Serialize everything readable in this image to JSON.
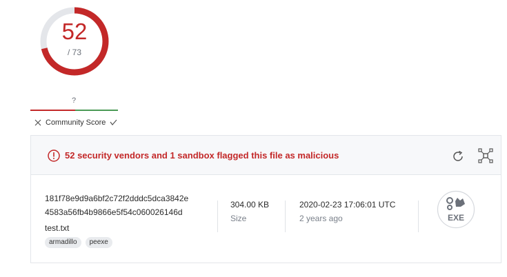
{
  "detection": {
    "score": "52",
    "total": "/ 73",
    "fraction": 0.712,
    "ring_color": "#c32828",
    "track_color": "#e4e6ea"
  },
  "community": {
    "question": "?",
    "label": "Community Score",
    "dislike_icon": "x-icon",
    "like_icon": "check-icon",
    "negative_color": "#c32828",
    "positive_color": "#4a9a55"
  },
  "alert": {
    "icon": "alert-circle-icon",
    "text": "52 security vendors and 1 sandbox flagged this file as malicious"
  },
  "actions": {
    "reanalyze_icon": "refresh-icon",
    "graph_icon": "graph-icon"
  },
  "file": {
    "hash_line1": "181f78e9d9a6bf2c72f2dddc5dca3842e",
    "hash_line2": "4583a56fb4b9866e5f54c060026146d",
    "name": "test.txt",
    "tags": [
      "armadillo",
      "peexe"
    ],
    "size_value": "304.00 KB",
    "size_label": "Size",
    "date_value": "2020-02-23 17:06:01 UTC",
    "date_relative": "2 years ago",
    "type_label": "EXE",
    "type_icon": "exe-file-icon"
  }
}
